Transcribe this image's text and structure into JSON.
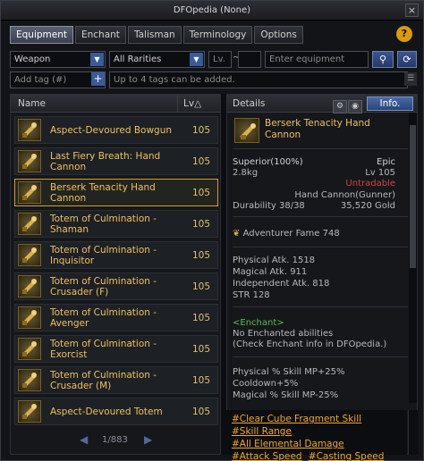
{
  "window": {
    "title": "DFOpedia (None)",
    "help": "?",
    "close": "×"
  },
  "tabs": [
    {
      "label": "Equipment",
      "active": true
    },
    {
      "label": "Enchant",
      "active": false
    },
    {
      "label": "Talisman",
      "active": false
    },
    {
      "label": "Terminology",
      "active": false
    },
    {
      "label": "Options",
      "active": false
    }
  ],
  "filters": {
    "type_value": "Weapon",
    "rarity_value": "All Rarities",
    "lv_placeholder": "Lv.",
    "lv_sep": "~",
    "name_placeholder": "Enter equipment name.",
    "tag_placeholder": "Add tag (#)",
    "tag_hint": "Up to 4 tags can be added."
  },
  "list": {
    "col_name": "Name",
    "col_lv": "Lv△",
    "items": [
      {
        "name": "Aspect-Devoured Bowgun",
        "lv": "105"
      },
      {
        "name": "Last Fiery Breath: Hand Cannon",
        "lv": "105"
      },
      {
        "name": "Berserk Tenacity Hand Cannon",
        "lv": "105"
      },
      {
        "name": "Totem of Culmination - Shaman",
        "lv": "105"
      },
      {
        "name": "Totem of Culmination - Inquisitor",
        "lv": "105"
      },
      {
        "name": "Totem of Culmination - Crusader (F)",
        "lv": "105"
      },
      {
        "name": "Totem of Culmination - Avenger",
        "lv": "105"
      },
      {
        "name": "Totem of Culmination - Exorcist",
        "lv": "105"
      },
      {
        "name": "Totem of Culmination - Crusader (M)",
        "lv": "105"
      },
      {
        "name": "Aspect-Devoured Totem",
        "lv": "105"
      }
    ],
    "pager": "1/883"
  },
  "details": {
    "header": "Details",
    "info_button": "Info.",
    "name": "Berserk Tenacity Hand Cannon",
    "grade": "Superior(100%)",
    "rarity": "Epic",
    "weight": "2.8kg",
    "level": "Lv 105",
    "trade": "Untradable",
    "type": "Hand Cannon(Gunner)",
    "durability": "Durability 38/38",
    "price": "35,520 Gold",
    "fame": "Adventurer Fame 748",
    "stats": [
      "Physical Atk. 1518",
      "Magical Atk. 911",
      "Independent Atk. 818",
      "STR 128"
    ],
    "enchant_title": "<Enchant>",
    "enchant_lines": [
      "No Enchanted abilities",
      "(Check Enchant info in DFOpedia.)"
    ],
    "options": [
      "Physical % Skill MP+25%",
      "Cooldown+5%",
      "Magical % Skill MP-25%"
    ],
    "tags": [
      "#Clear Cube Fragment Skill",
      "#Skill Range",
      "#All Elemental Damage",
      "#Attack Speed",
      "#Casting Speed"
    ]
  },
  "colors": {
    "accent": "#d3a02a",
    "epic": "#f0c060",
    "untradable": "#d94040",
    "enchant": "#50c050",
    "tag": "#f0a830"
  }
}
